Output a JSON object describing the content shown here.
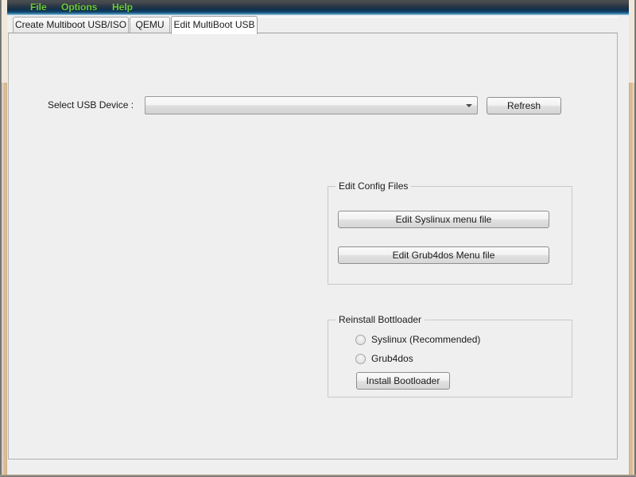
{
  "window": {
    "frame_color": "#dcbb92",
    "client_bg": "#efefef"
  },
  "menu_bar": {
    "text_color": "#6ecb3a",
    "items": [
      {
        "label": "File"
      },
      {
        "label": "Options"
      },
      {
        "label": "Help"
      }
    ]
  },
  "tabs": {
    "active_index": 2,
    "items": [
      {
        "label": "Create Multiboot USB/ISO"
      },
      {
        "label": "QEMU"
      },
      {
        "label": "Edit MultiBoot USB"
      }
    ]
  },
  "usb_device": {
    "label": "Select USB Device :",
    "selected_value": "",
    "placeholder": "",
    "dropdown_icon": "chevron-down-icon",
    "refresh_label": "Refresh"
  },
  "edit_config": {
    "title": "Edit Config Files",
    "buttons": [
      {
        "label": "Edit  Syslinux menu file"
      },
      {
        "label": "Edit Grub4dos Menu file"
      }
    ]
  },
  "reinstall_bootloader": {
    "title": "Reinstall Bottloader",
    "options": [
      {
        "label": "Syslinux    (Recommended)",
        "selected": false
      },
      {
        "label": "Grub4dos",
        "selected": false
      }
    ],
    "install_label": "Install Bootloader"
  }
}
